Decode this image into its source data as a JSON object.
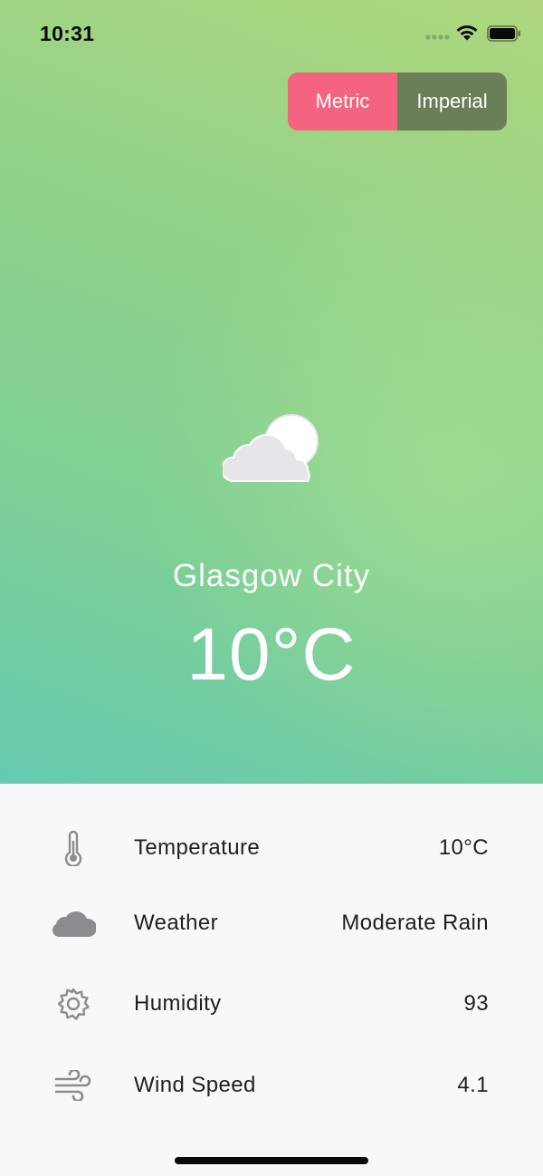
{
  "status_bar": {
    "time": "10:31"
  },
  "unit_toggle": {
    "metric_label": "Metric",
    "imperial_label": "Imperial",
    "selected": "Metric"
  },
  "current": {
    "icon": "partly-cloudy-icon",
    "city": "Glasgow City",
    "temperature": "10°C"
  },
  "details": [
    {
      "icon": "thermometer-icon",
      "label": "Temperature",
      "value": "10°C"
    },
    {
      "icon": "cloud-icon",
      "label": "Weather",
      "value": "Moderate Rain"
    },
    {
      "icon": "gear-icon",
      "label": "Humidity",
      "value": "93"
    },
    {
      "icon": "wind-icon",
      "label": "Wind Speed",
      "value": "4.1"
    }
  ],
  "colors": {
    "metric_active": "#f4637f",
    "imperial_inactive": "#6a7f57",
    "gradient_top": "#aed67c",
    "gradient_bottom": "#66c9b0"
  }
}
